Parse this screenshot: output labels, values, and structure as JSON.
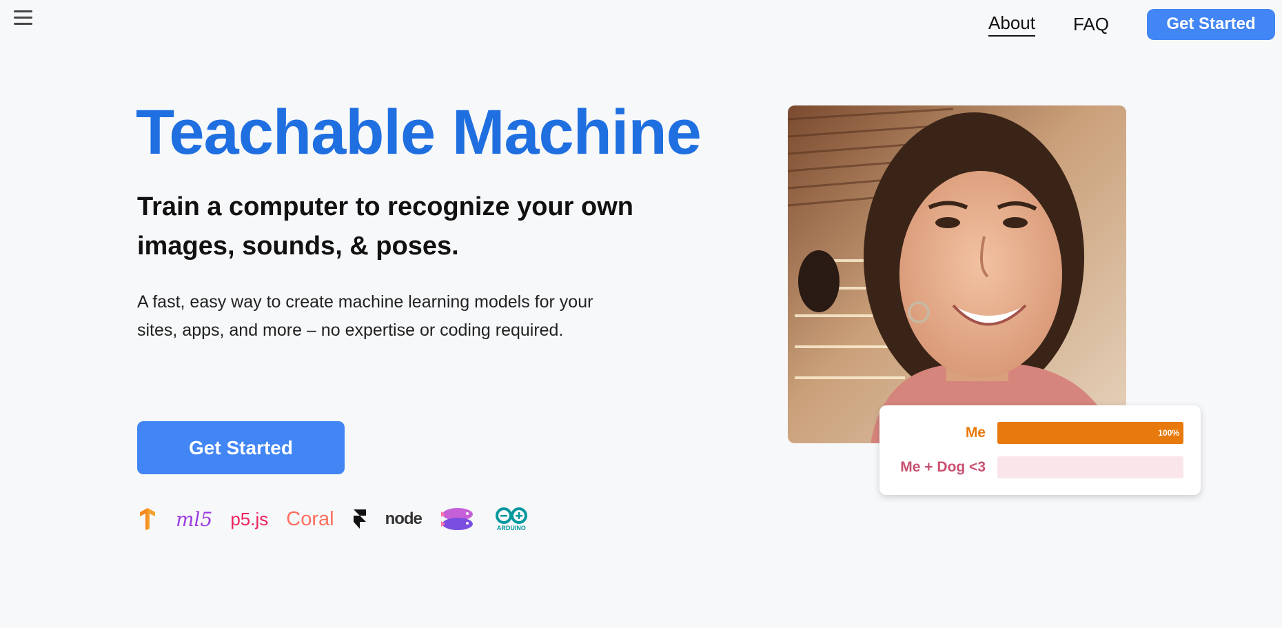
{
  "nav": {
    "menu_icon": "hamburger-menu-icon",
    "about_label": "About",
    "faq_label": "FAQ",
    "cta_label": "Get Started"
  },
  "hero": {
    "title": "Teachable Machine",
    "subtitle": "Train a computer to recognize your own images, sounds, & poses.",
    "description": "A fast, easy way to create machine learning models for your sites, apps, and more – no expertise or coding required.",
    "cta_label": "Get Started",
    "accent_color": "#1f6fe0",
    "button_color": "#4285f4"
  },
  "logos": [
    {
      "name": "tensorflow-logo",
      "text": ""
    },
    {
      "name": "ml5-logo",
      "text": "ml5"
    },
    {
      "name": "p5js-logo",
      "text": "p5.js"
    },
    {
      "name": "coral-logo",
      "text": "Coral"
    },
    {
      "name": "framer-logo",
      "text": ""
    },
    {
      "name": "node-logo",
      "text": "node"
    },
    {
      "name": "glitch-logo",
      "text": ""
    },
    {
      "name": "arduino-logo",
      "text": "ARDUINO"
    }
  ],
  "predictions": [
    {
      "label": "Me",
      "value": 1.0,
      "percent_text": "100%",
      "color": "#e8790c",
      "track_color": "#e8790c"
    },
    {
      "label": "Me + Dog <3",
      "value": 0.0,
      "percent_text": "",
      "color": "#c9516f",
      "track_color": "#f9e5ea"
    }
  ]
}
